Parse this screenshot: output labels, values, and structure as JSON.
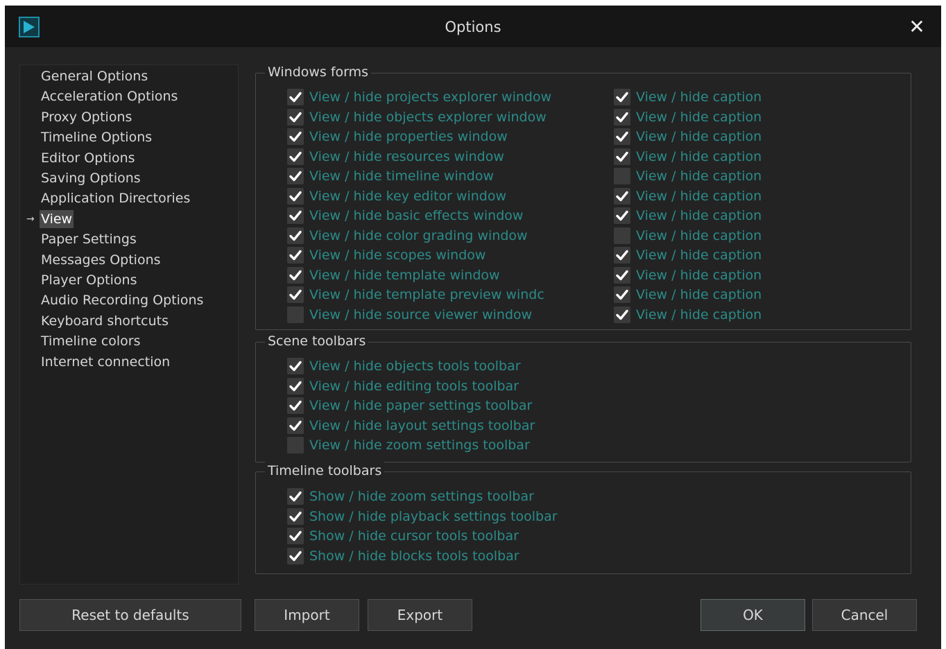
{
  "window": {
    "title": "Options"
  },
  "sidebar": {
    "items": [
      {
        "label": "General Options",
        "selected": false
      },
      {
        "label": "Acceleration Options",
        "selected": false
      },
      {
        "label": "Proxy Options",
        "selected": false
      },
      {
        "label": "Timeline Options",
        "selected": false
      },
      {
        "label": "Editor Options",
        "selected": false
      },
      {
        "label": "Saving Options",
        "selected": false
      },
      {
        "label": "Application Directories",
        "selected": false
      },
      {
        "label": "View",
        "selected": true
      },
      {
        "label": "Paper Settings",
        "selected": false
      },
      {
        "label": "Messages Options",
        "selected": false
      },
      {
        "label": "Player Options",
        "selected": false
      },
      {
        "label": "Audio Recording Options",
        "selected": false
      },
      {
        "label": "Keyboard shortcuts",
        "selected": false
      },
      {
        "label": "Timeline colors",
        "selected": false
      },
      {
        "label": "Internet connection",
        "selected": false
      }
    ],
    "selected_marker": "→"
  },
  "windows_forms": {
    "title": "Windows forms",
    "rows": [
      {
        "label": "View / hide projects explorer window",
        "checked": true,
        "caption_label": "View / hide caption",
        "caption_checked": true
      },
      {
        "label": "View / hide objects explorer window",
        "checked": true,
        "caption_label": "View / hide caption",
        "caption_checked": true
      },
      {
        "label": "View / hide properties window",
        "checked": true,
        "caption_label": "View / hide caption",
        "caption_checked": true
      },
      {
        "label": "View / hide resources window",
        "checked": true,
        "caption_label": "View / hide caption",
        "caption_checked": true
      },
      {
        "label": "View / hide timeline window",
        "checked": true,
        "caption_label": "View / hide caption",
        "caption_checked": false
      },
      {
        "label": "View / hide key editor window",
        "checked": true,
        "caption_label": "View / hide caption",
        "caption_checked": true
      },
      {
        "label": "View / hide basic effects window",
        "checked": true,
        "caption_label": "View / hide caption",
        "caption_checked": true
      },
      {
        "label": "View / hide color grading window",
        "checked": true,
        "caption_label": "View / hide caption",
        "caption_checked": false
      },
      {
        "label": "View / hide scopes window",
        "checked": true,
        "caption_label": "View / hide caption",
        "caption_checked": true
      },
      {
        "label": "View / hide template window",
        "checked": true,
        "caption_label": "View / hide caption",
        "caption_checked": true
      },
      {
        "label": "View / hide template preview windc",
        "checked": true,
        "caption_label": "View / hide caption",
        "caption_checked": true
      },
      {
        "label": "View / hide source viewer window",
        "checked": false,
        "caption_label": "View / hide caption",
        "caption_checked": true
      }
    ]
  },
  "scene_toolbars": {
    "title": "Scene toolbars",
    "items": [
      {
        "label": "View / hide objects tools toolbar",
        "checked": true
      },
      {
        "label": "View / hide editing tools toolbar",
        "checked": true
      },
      {
        "label": "View / hide paper settings toolbar",
        "checked": true
      },
      {
        "label": "View / hide layout settings toolbar",
        "checked": true
      },
      {
        "label": "View / hide zoom settings toolbar",
        "checked": false
      }
    ]
  },
  "timeline_toolbars": {
    "title": "Timeline toolbars",
    "items": [
      {
        "label": "Show / hide zoom settings toolbar",
        "checked": true
      },
      {
        "label": "Show / hide playback settings toolbar",
        "checked": true
      },
      {
        "label": "Show / hide cursor tools toolbar",
        "checked": true
      },
      {
        "label": "Show / hide blocks tools toolbar",
        "checked": true
      }
    ]
  },
  "buttons": {
    "reset": "Reset to defaults",
    "import": "Import",
    "export": "Export",
    "ok": "OK",
    "cancel": "Cancel"
  },
  "icons": {
    "app": "app-logo-icon",
    "close": "close-icon",
    "check": "checkmark-icon"
  },
  "colors": {
    "background": "#232323",
    "titlebar": "#161616",
    "option_text": "#2b8c8a",
    "checkbox": "#3b3b3b"
  }
}
